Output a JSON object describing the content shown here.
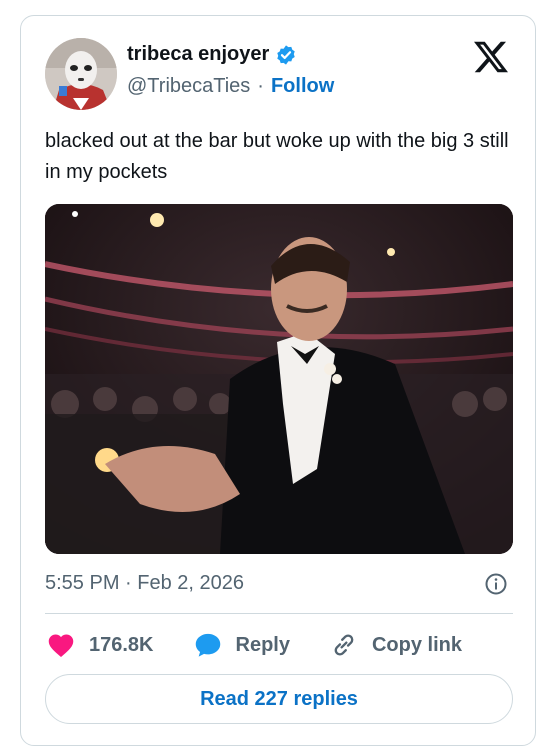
{
  "author": {
    "display_name": "tribeca enjoyer",
    "handle": "@TribecaTies",
    "separator": "·",
    "follow_label": "Follow"
  },
  "tweet": {
    "text": "blacked out at the bar but woke up with the big 3 still in my pockets",
    "timestamp": "5:55 PM · Feb 2, 2026"
  },
  "actions": {
    "like_count": "176.8K",
    "reply_label": "Reply",
    "copy_link_label": "Copy link"
  },
  "read_replies_label": "Read 227 replies",
  "colors": {
    "accent": "#0b72c6",
    "like": "#f91880",
    "verified": "#1d9bf0",
    "muted_text": "#536471",
    "border": "#cfd9de"
  }
}
